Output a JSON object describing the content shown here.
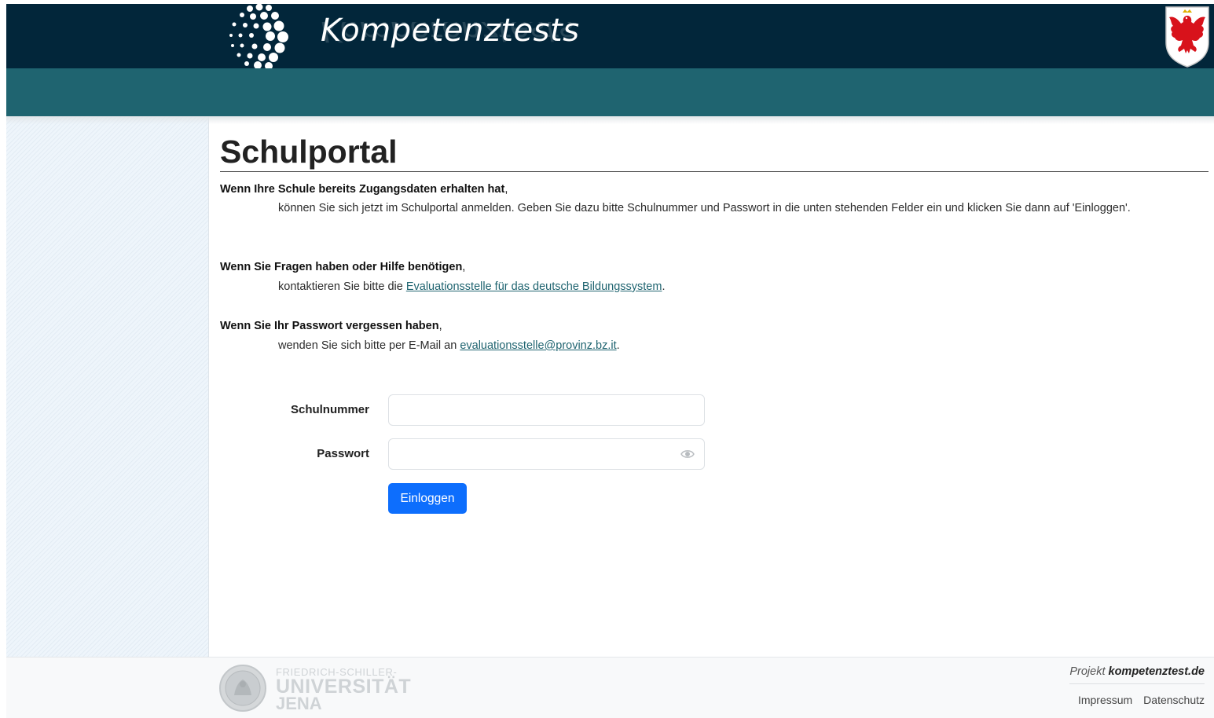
{
  "header": {
    "brand": "Kompetenztests",
    "brand_reflection": "Kompetenztests"
  },
  "main": {
    "title": "Schulportal",
    "sections": [
      {
        "heading": "Wenn Ihre Schule bereits Zugangsdaten erhalten hat",
        "text": "können Sie sich jetzt im Schulportal anmelden. Geben Sie dazu bitte Schulnummer und Passwort in die unten stehenden Felder ein und klicken Sie dann auf 'Einloggen'."
      },
      {
        "heading": "Wenn Sie Fragen haben oder Hilfe benötigen",
        "text_before": "kontaktieren Sie bitte die ",
        "link": "Evaluationsstelle für das deutsche Bildungssystem",
        "text_after": "."
      },
      {
        "heading": "Wenn Sie Ihr Passwort vergessen haben",
        "text_before": "wenden Sie sich bitte per E-Mail an ",
        "link": "evaluationsstelle@provinz.bz.it",
        "text_after": "."
      }
    ],
    "comma": ","
  },
  "form": {
    "school_number_label": "Schulnummer",
    "school_number_value": "",
    "password_label": "Passwort",
    "password_value": "",
    "submit_label": "Einloggen"
  },
  "footer": {
    "university_line1": "FRIEDRICH-SCHILLER-",
    "university_line2": "UNIVERSITÄT",
    "university_line3": "JENA",
    "project_prefix": "Projekt",
    "project_name": "kompetenztest.de",
    "links": [
      "Impressum",
      "Datenschutz"
    ]
  },
  "colors": {
    "header_dark": "#02263a",
    "header_teal": "#1f6470",
    "button_primary": "#0d6efd",
    "link": "#1f6470"
  },
  "icons": {
    "logo": "dotted-sphere-logo",
    "crest": "tyrolean-eagle-crest",
    "password_toggle": "eye-icon",
    "seal": "university-seal"
  }
}
